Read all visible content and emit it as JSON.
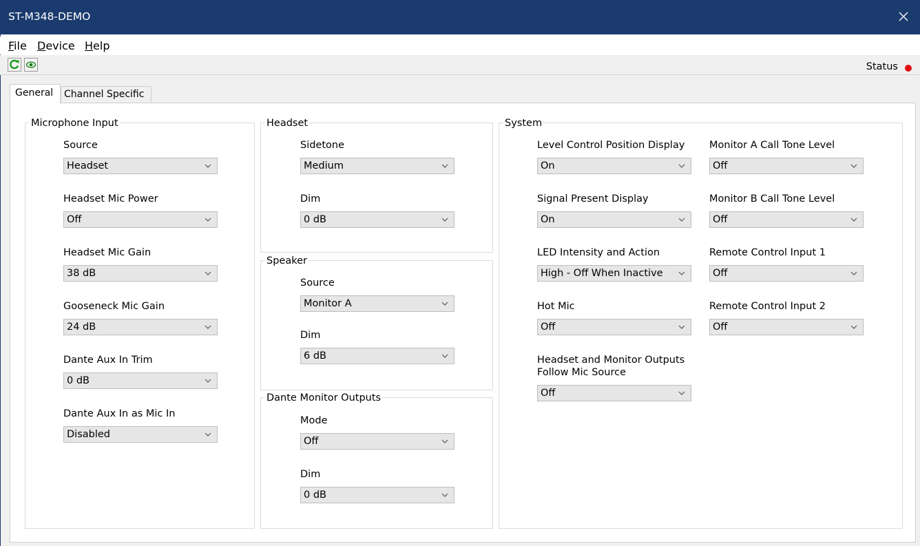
{
  "window": {
    "title": "ST-M348-DEMO"
  },
  "menu": {
    "file": "File",
    "device": "Device",
    "help": "Help"
  },
  "toolbar": {
    "status_label": "Status",
    "status_color": "#e01010"
  },
  "tabs": {
    "general": "General",
    "channel_specific": "Channel Specific"
  },
  "microphone_input": {
    "title": "Microphone Input",
    "source": {
      "label": "Source",
      "value": "Headset"
    },
    "headset_mic_power": {
      "label": "Headset Mic Power",
      "value": "Off"
    },
    "headset_mic_gain": {
      "label": "Headset Mic Gain",
      "value": "38 dB"
    },
    "gooseneck_mic_gain": {
      "label": "Gooseneck Mic Gain",
      "value": "24 dB"
    },
    "dante_aux_in_trim": {
      "label": "Dante Aux In Trim",
      "value": "0 dB"
    },
    "dante_aux_in_as_mic_in": {
      "label": "Dante Aux In as Mic In",
      "value": "Disabled"
    }
  },
  "headset": {
    "title": "Headset",
    "sidetone": {
      "label": "Sidetone",
      "value": "Medium"
    },
    "dim": {
      "label": "Dim",
      "value": "0 dB"
    }
  },
  "speaker": {
    "title": "Speaker",
    "source": {
      "label": "Source",
      "value": "Monitor A"
    },
    "dim": {
      "label": "Dim",
      "value": "6 dB"
    }
  },
  "dante_monitor_outputs": {
    "title": "Dante Monitor Outputs",
    "mode": {
      "label": "Mode",
      "value": "Off"
    },
    "dim": {
      "label": "Dim",
      "value": "0 dB"
    }
  },
  "system": {
    "title": "System",
    "level_control_position_display": {
      "label": "Level Control Position Display",
      "value": "On"
    },
    "signal_present_display": {
      "label": "Signal Present Display",
      "value": "On"
    },
    "led_intensity_and_action": {
      "label": "LED Intensity and Action",
      "value": "High - Off When Inactive"
    },
    "hot_mic": {
      "label": "Hot Mic",
      "value": "Off"
    },
    "headset_monitor_follow": {
      "label_line1": "Headset and Monitor Outputs",
      "label_line2": "Follow Mic Source",
      "value": "Off"
    },
    "monitor_a_call_tone_level": {
      "label": "Monitor A Call Tone Level",
      "value": "Off"
    },
    "monitor_b_call_tone_level": {
      "label": "Monitor B Call Tone Level",
      "value": "Off"
    },
    "remote_control_input_1": {
      "label": "Remote Control Input 1",
      "value": "Off"
    },
    "remote_control_input_2": {
      "label": "Remote Control Input 2",
      "value": "Off"
    }
  }
}
